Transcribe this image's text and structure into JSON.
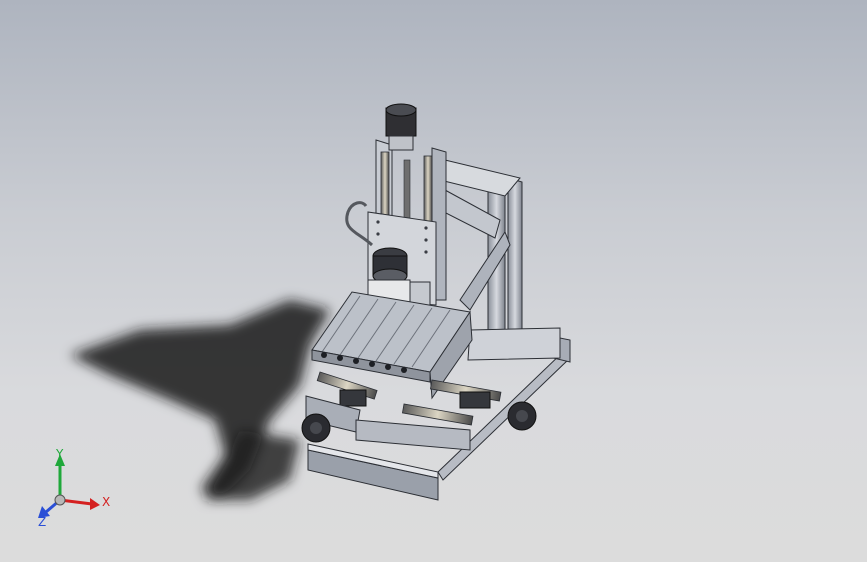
{
  "viewport": {
    "background_top": "#aeb4bf",
    "background_bottom": "#dcdcdc",
    "model": "cnc-router-assembly"
  },
  "triad": {
    "x_label": "X",
    "y_label": "Y",
    "z_label": "Z",
    "x_color": "#d42020",
    "y_color": "#1fa83a",
    "z_color": "#2a4fd6"
  }
}
